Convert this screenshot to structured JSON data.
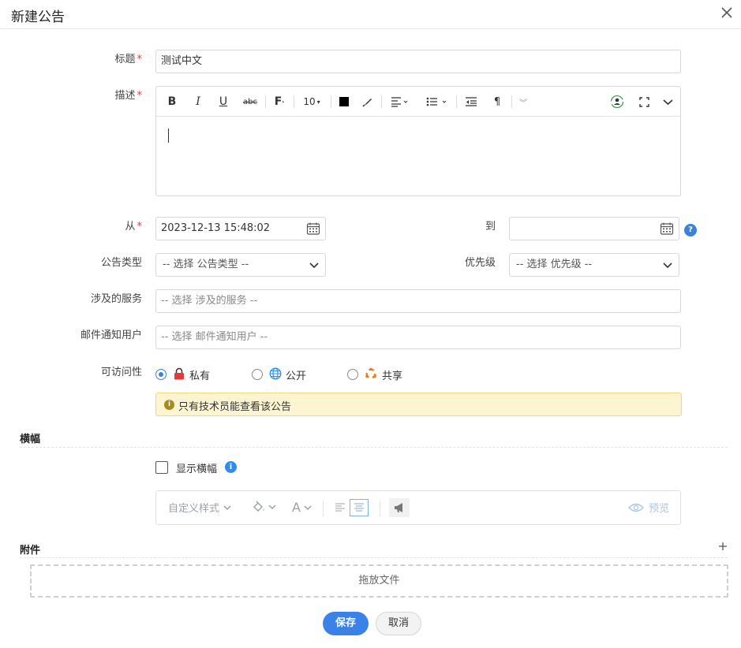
{
  "dialog": {
    "title": "新建公告",
    "close_icon": "close-icon"
  },
  "form": {
    "title_label": "标题",
    "title_value": "测试中文",
    "desc_label": "描述",
    "from_label": "从",
    "from_value": "2023-12-13 15:48:02",
    "to_label": "到",
    "to_value": "",
    "help_text": "?",
    "type_label": "公告类型",
    "type_placeholder": "-- 选择 公告类型 --",
    "priority_label": "优先级",
    "priority_placeholder": "-- 选择 优先级 --",
    "services_label": "涉及的服务",
    "services_placeholder": "-- 选择 涉及的服务 --",
    "email_label": "邮件通知用户",
    "email_placeholder": "-- 选择 邮件通知用户 --",
    "visibility_label": "可访问性",
    "visibility_options": [
      {
        "label": "私有",
        "checked": true,
        "icon": "lock-icon"
      },
      {
        "label": "公开",
        "checked": false,
        "icon": "globe-icon"
      },
      {
        "label": "共享",
        "checked": false,
        "icon": "share-icon"
      }
    ],
    "notice_text": "只有技术员能查看该公告",
    "notice_icon_text": "i"
  },
  "editor_toolbar": {
    "bold": "B",
    "italic": "I",
    "underline": "U",
    "strike": "abc",
    "font": "F",
    "font_size": "10"
  },
  "banner": {
    "section_title": "横幅",
    "show_label": "显示横幅",
    "info_text": "i",
    "style_label": "自定义样式",
    "font_a": "A",
    "preview_label": "预览"
  },
  "attachments": {
    "section_title": "附件",
    "drop_text": "拖放文件"
  },
  "buttons": {
    "save": "保存",
    "cancel": "取消"
  },
  "colors": {
    "primary": "#3b82e8",
    "required": "#e53935",
    "notice_bg": "#fdf5d1"
  }
}
